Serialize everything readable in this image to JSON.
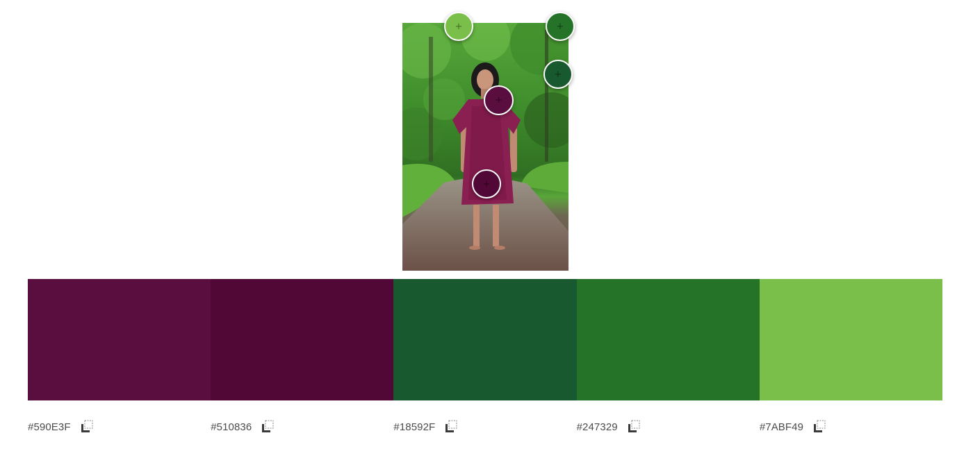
{
  "image": {
    "alt_icon": "photo-of-person-in-forest"
  },
  "pickers": [
    {
      "name": "light-green",
      "color": "#7ABF49"
    },
    {
      "name": "green",
      "color": "#247329"
    },
    {
      "name": "dark-green",
      "color": "#18592F"
    },
    {
      "name": "plum-upper",
      "color": "#590E3F"
    },
    {
      "name": "plum-lower",
      "color": "#510836"
    }
  ],
  "swatches": [
    {
      "hex": "#590E3F",
      "color": "#590E3F",
      "copy_icon": "copy-icon"
    },
    {
      "hex": "#510836",
      "color": "#510836",
      "copy_icon": "copy-icon"
    },
    {
      "hex": "#18592F",
      "color": "#18592F",
      "copy_icon": "copy-icon"
    },
    {
      "hex": "#247329",
      "color": "#247329",
      "copy_icon": "copy-icon"
    },
    {
      "hex": "#7ABF49",
      "color": "#7ABF49",
      "copy_icon": "copy-icon"
    }
  ]
}
